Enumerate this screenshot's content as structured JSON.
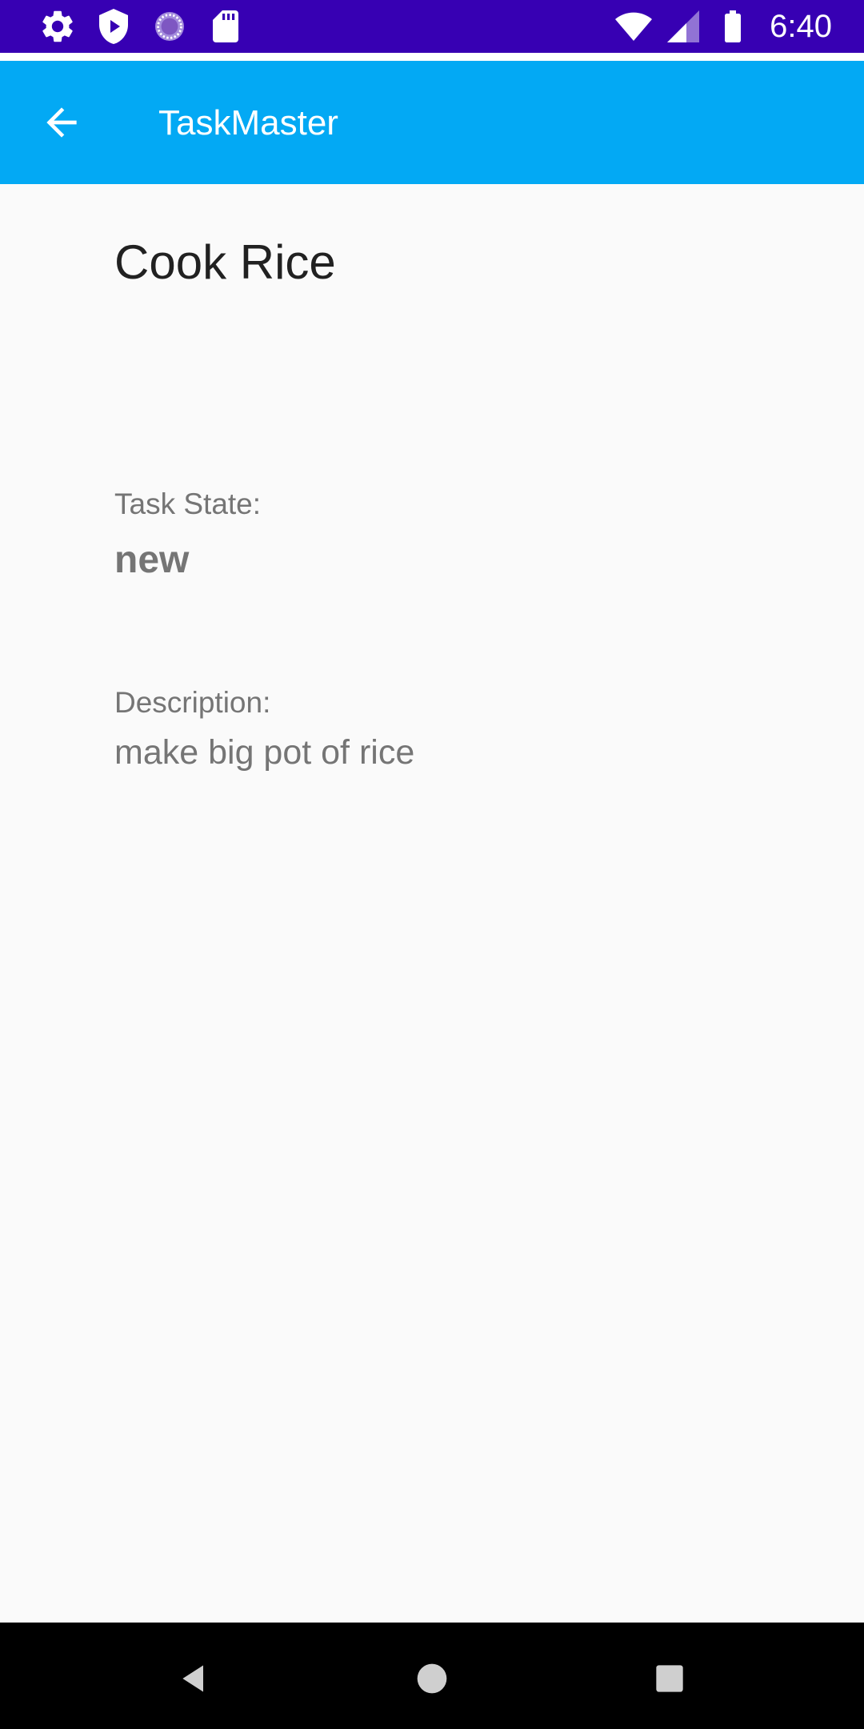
{
  "status_bar": {
    "time": "6:40",
    "left_icons": [
      "gear-icon",
      "shield-play-icon",
      "sync-circle-icon",
      "sd-card-icon"
    ],
    "right_icons": [
      "wifi-icon",
      "signal-icon",
      "battery-icon"
    ],
    "background": "#3700b3"
  },
  "app_bar": {
    "title": "TaskMaster",
    "back_icon": "arrow-back-icon",
    "background": "#03a9f4"
  },
  "task": {
    "title": "Cook Rice",
    "state_label": "Task State:",
    "state_value": "new",
    "description_label": "Description:",
    "description_value": "make big pot of rice"
  },
  "nav_bar": {
    "buttons": [
      "nav-back-icon",
      "nav-home-icon",
      "nav-recents-icon"
    ]
  }
}
